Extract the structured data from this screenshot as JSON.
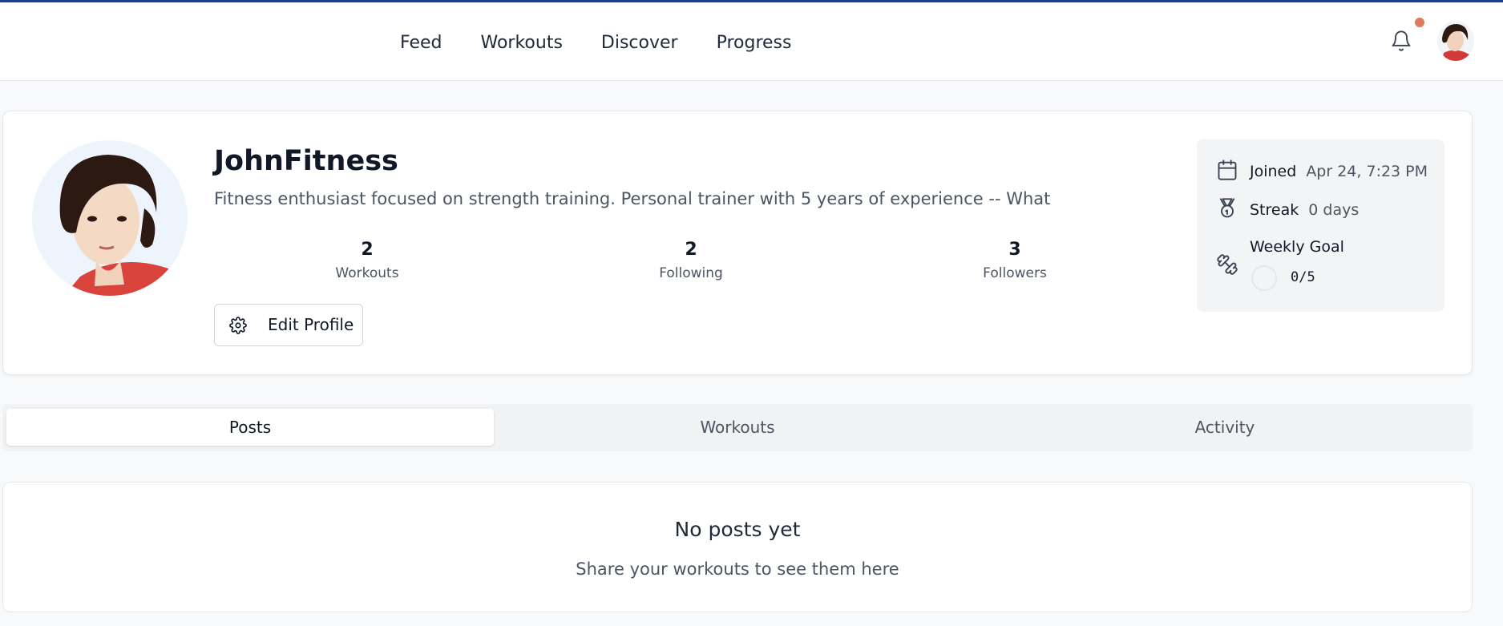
{
  "nav": {
    "links": [
      "Feed",
      "Workouts",
      "Discover",
      "Progress"
    ],
    "notification_dot_color": "#e07a5f",
    "bell_icon": "bell-icon"
  },
  "profile": {
    "username": "JohnFitness",
    "bio": "Fitness enthusiast focused on strength training. Personal trainer with 5 years of experience -- What",
    "stats": [
      {
        "value": "2",
        "label": "Workouts"
      },
      {
        "value": "2",
        "label": "Following"
      },
      {
        "value": "3",
        "label": "Followers"
      }
    ],
    "edit_button": "Edit Profile"
  },
  "info": {
    "joined_label": "Joined",
    "joined_value": "Apr 24, 7:23 PM",
    "streak_label": "Streak",
    "streak_value": "0 days",
    "goal_label": "Weekly Goal",
    "goal_value": "0/5",
    "goal_progress": 0
  },
  "tabs": [
    "Posts",
    "Workouts",
    "Activity"
  ],
  "active_tab": "Posts",
  "posts": {
    "empty_title": "No posts yet",
    "empty_subtitle": "Share your workouts to see them here"
  }
}
